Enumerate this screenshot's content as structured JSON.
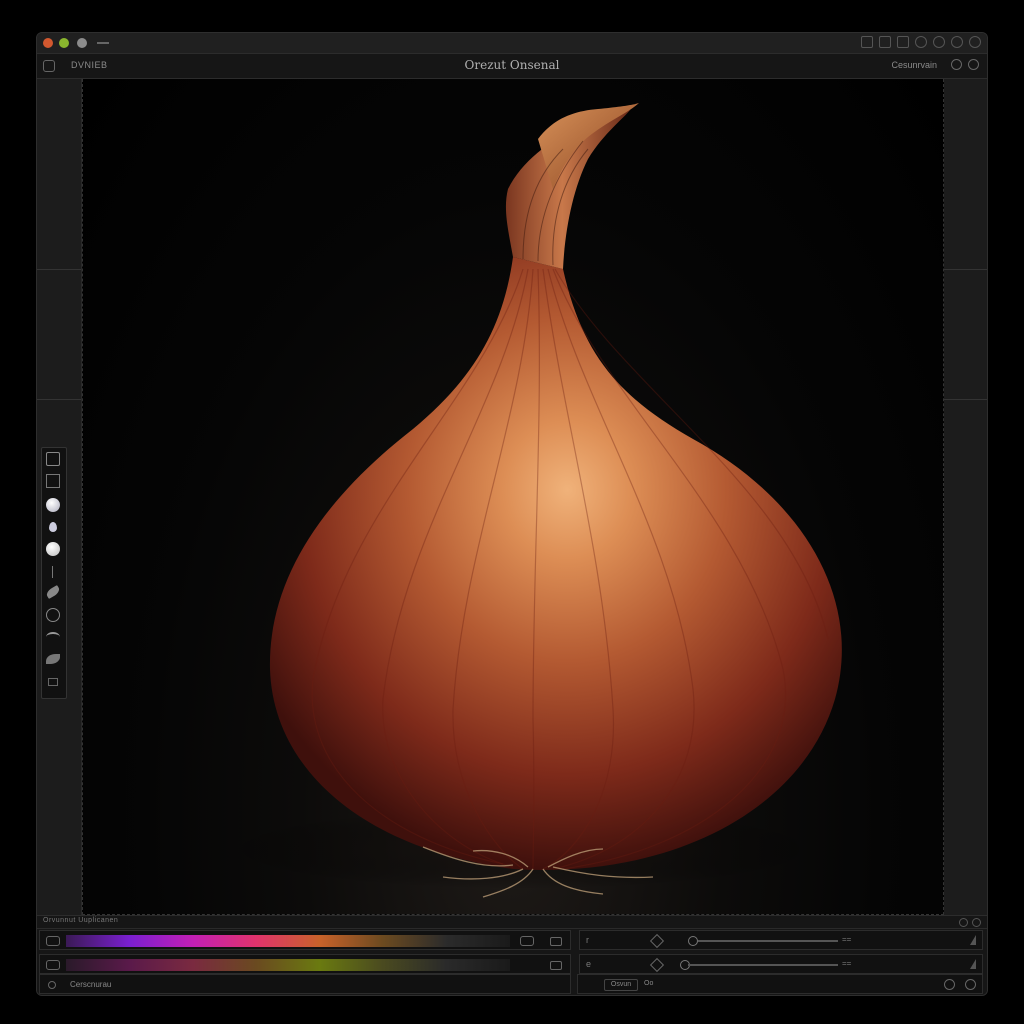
{
  "window": {
    "title": "Orezut Onsenal",
    "toolbar_left_label": "DVNIEB",
    "toolbar_right_label": "Cesunrvain"
  },
  "bottom_panel": {
    "title": "Orvunnut Uuplicanen",
    "gradient_rows": [
      {
        "id": "row-1",
        "colors": [
          "#3a1a55",
          "#7a1fd0",
          "#c21fb5",
          "#e0336c",
          "#c8622a",
          "#6b4a20",
          "#2b2b2b",
          "#1a1a1a"
        ]
      },
      {
        "id": "row-2",
        "colors": [
          "#2a1a2a",
          "#5a1a4a",
          "#7a2a40",
          "#6a4a20",
          "#6a7a10",
          "#4a4a20",
          "#2a2a2a",
          "#1a1a1a"
        ]
      }
    ],
    "sliders": [
      {
        "label": "r",
        "value_text": "=="
      },
      {
        "label": "e",
        "value_text": "=="
      }
    ],
    "status": {
      "left_text": "Cerscnurau",
      "right_chip": "Osvun",
      "right_text": "Oo"
    }
  },
  "colors": {
    "onion_light": "#e0995e",
    "onion_mid": "#a5482b",
    "onion_dark": "#3f100c",
    "background": "#000000"
  },
  "icons": {
    "left_tools": [
      "square-icon",
      "frame-icon",
      "sphere-icon",
      "droplet-icon",
      "sphere-icon",
      "line-icon",
      "brush-icon",
      "circle-icon",
      "eye-icon",
      "leaf-icon",
      "small-square-icon"
    ]
  }
}
